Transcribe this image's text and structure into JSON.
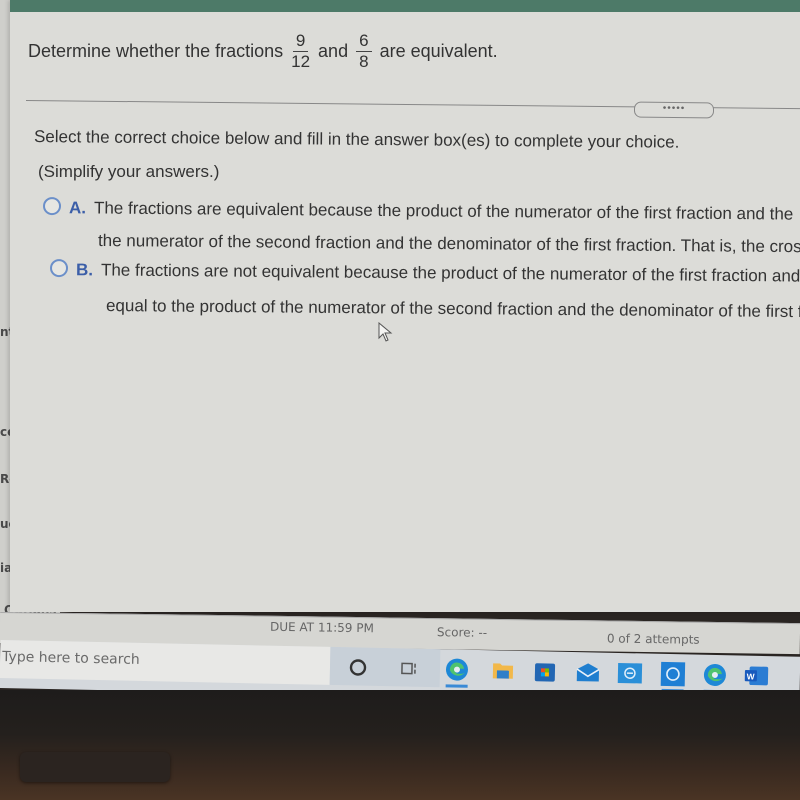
{
  "sidebar": {
    "items": [
      {
        "label": "nts"
      },
      {
        "label": "cess"
      },
      {
        "label": "Resourc"
      },
      {
        "label": "uccess"
      },
      {
        "label": "ia Library"
      },
      {
        "label": "Options"
      }
    ]
  },
  "question": {
    "prefix": "Determine whether the fractions",
    "fraction1": {
      "numerator": "9",
      "denominator": "12"
    },
    "connector": "and",
    "fraction2": {
      "numerator": "6",
      "denominator": "8"
    },
    "suffix": "are equivalent."
  },
  "more_button": {
    "label": "•••••"
  },
  "instruction": "Select the correct choice below and fill in the answer box(es) to complete your choice.",
  "simplify_note": "(Simplify your answers.)",
  "choices": [
    {
      "letter": "A.",
      "line1": "The fractions are equivalent because the product of the numerator of the first fraction and the",
      "line2": "the numerator of the second fraction and the denominator of the first fraction. That is, the cros",
      "selected": false
    },
    {
      "letter": "B.",
      "line1": "The fractions are not equivalent because the product of the numerator of the first fraction and th",
      "line2": "equal to the product of the numerator of the second fraction and the denominator of the first frac",
      "selected": false
    }
  ],
  "status": {
    "due": "DUE AT 11:59 PM",
    "score": "Score: --",
    "attempts": "0 of 2 attempts"
  },
  "taskbar": {
    "search_placeholder": "Type here to search",
    "icons": [
      "cortana-icon",
      "task-view-icon",
      "edge-icon",
      "file-explorer-icon",
      "store-icon",
      "mail-icon",
      "app-icon",
      "app-icon-2",
      "edge-icon-2",
      "word-icon"
    ]
  },
  "colors": {
    "topbar": "#4d7a68",
    "choice_letter": "#3b5ea8",
    "radio_border": "#6b8fc9",
    "taskbar_accent": "#3a8ad6"
  }
}
